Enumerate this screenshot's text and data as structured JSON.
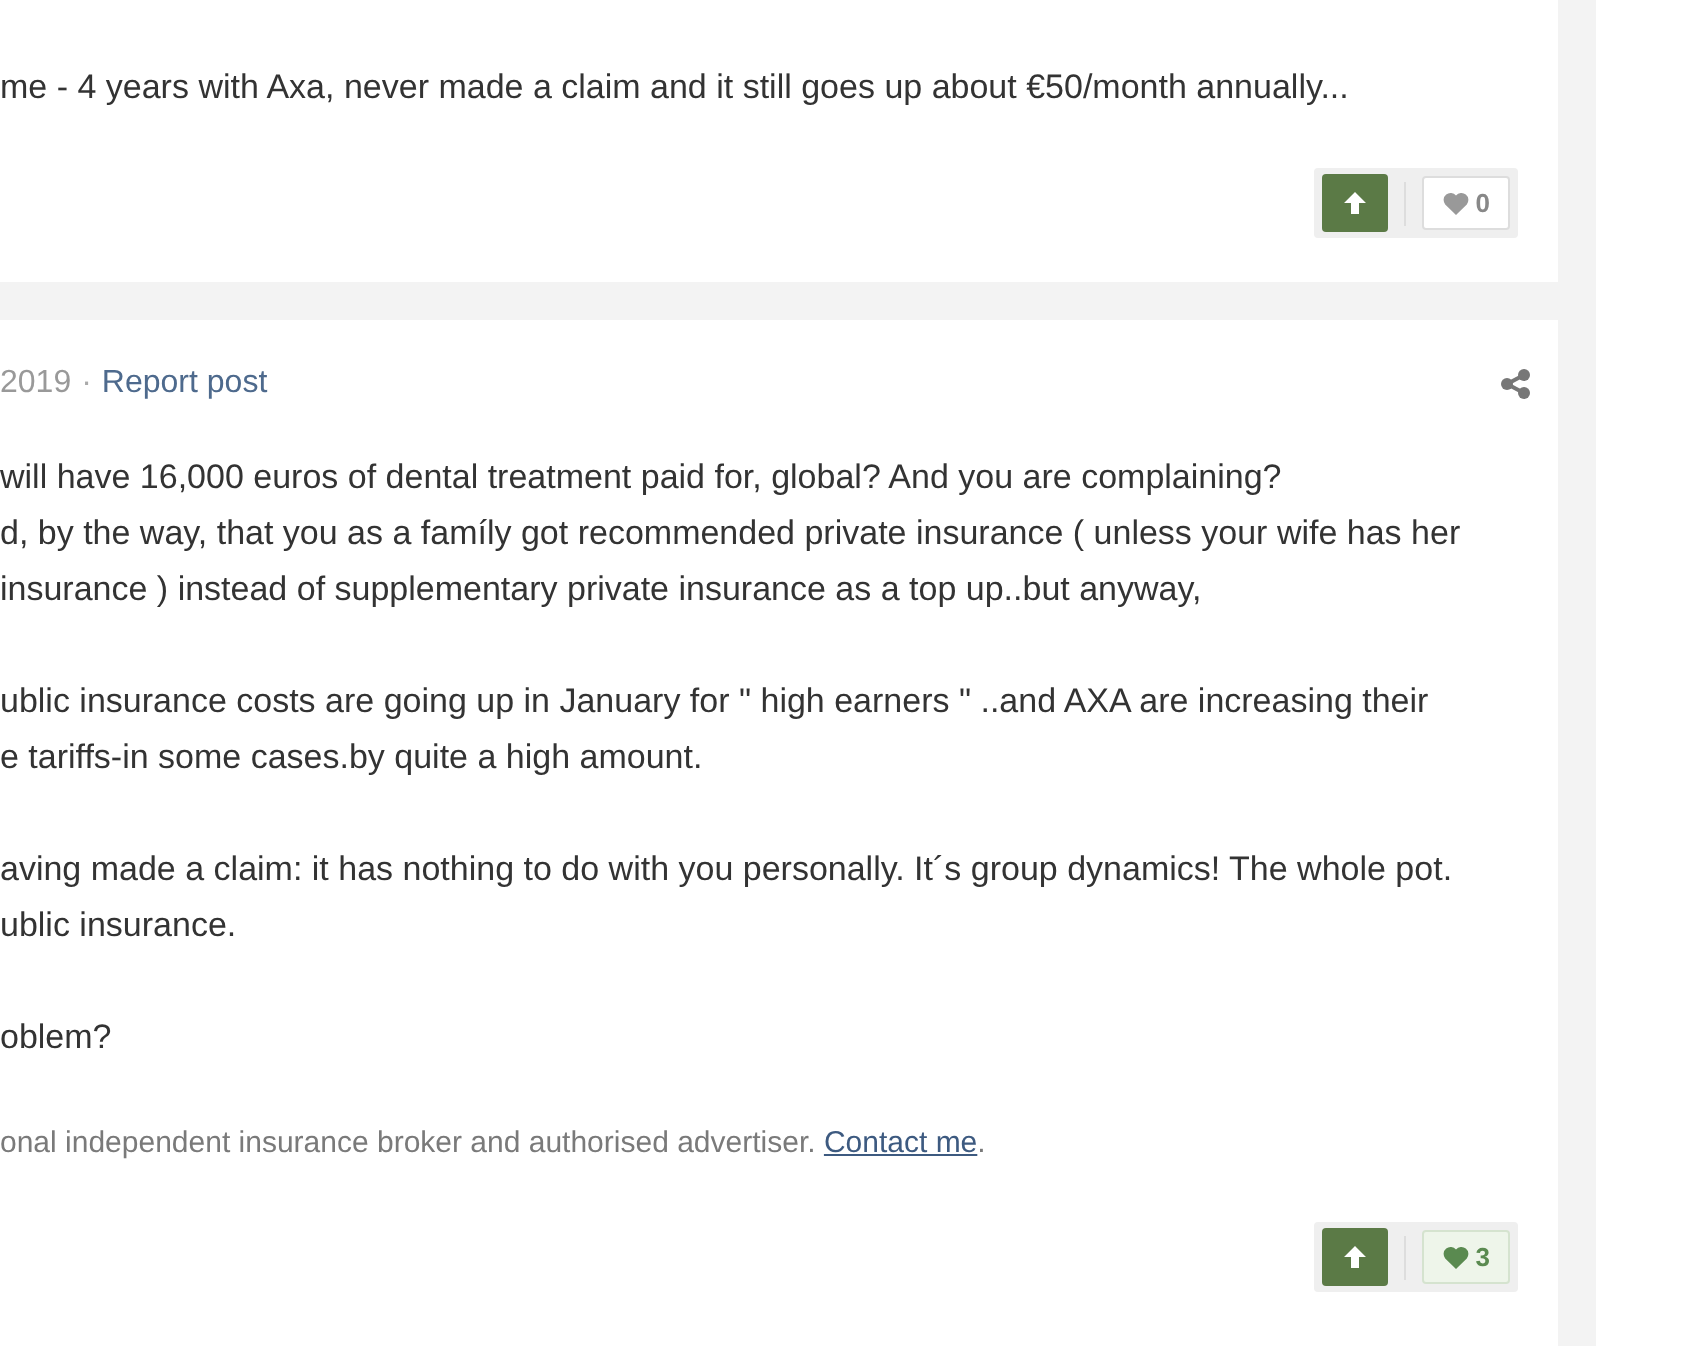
{
  "posts": [
    {
      "paragraphs": [
        [
          "me - 4 years with Axa, never made a claim and it still goes up about €50/month annually..."
        ]
      ],
      "reaction": {
        "count": "0",
        "reacted": false
      }
    },
    {
      "meta": {
        "date": "2019",
        "separator": "·",
        "report": "Report post"
      },
      "paragraphs": [
        [
          "will have 16,000 euros of dental treatment paid for, global? And you are complaining?",
          "d, by the way, that you as a famíly got recommended private insurance ( unless your wife has her",
          "insurance ) instead of supplementary private insurance as a top up..but anyway,"
        ],
        [
          "ublic insurance costs are going up in January for \" high earners \" ..and AXA are increasing their",
          "e tariffs-in some cases.by quite a high amount."
        ],
        [
          "aving made a claim: it has nothing to do with you personally. It´s group dynamics! The whole pot.",
          "ublic insurance."
        ],
        [
          "oblem?"
        ]
      ],
      "signature": {
        "text": "onal independent insurance broker and authorised advertiser.",
        "link": "Contact me",
        "after": "."
      },
      "reaction": {
        "count": "3",
        "reacted": true
      }
    }
  ]
}
